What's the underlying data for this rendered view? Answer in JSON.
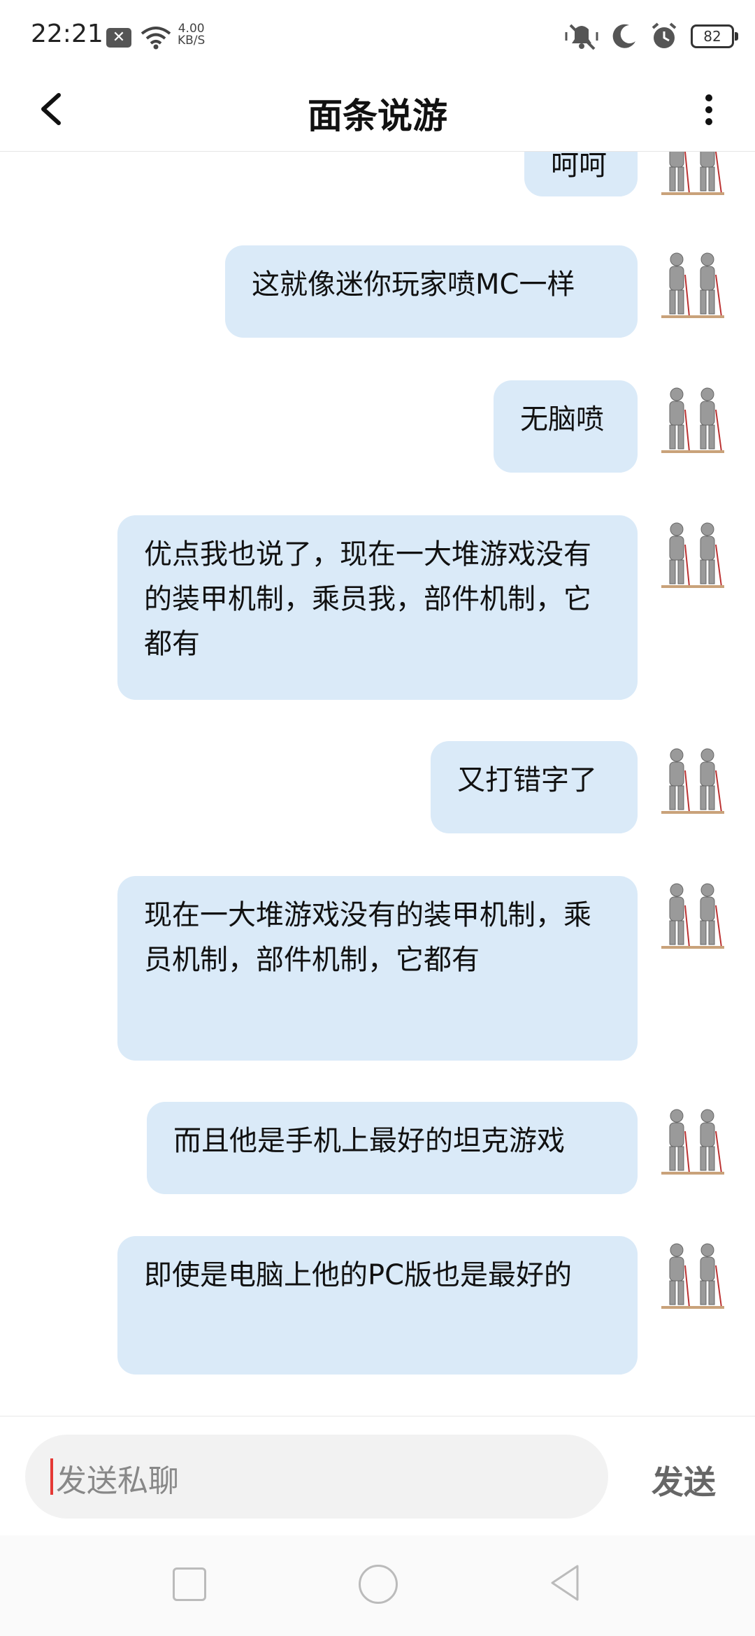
{
  "status_bar": {
    "time": "22:21",
    "net_speed_value": "4.00",
    "net_speed_unit": "KB/S",
    "battery": "82",
    "icons": [
      "notification-x-icon",
      "wifi-icon",
      "mute-vibrate-icon",
      "moon-icon",
      "alarm-icon",
      "battery-icon"
    ]
  },
  "header": {
    "title": "面条说游",
    "back_icon": "chevron-left-icon",
    "more_icon": "more-vertical-icon"
  },
  "messages": [
    {
      "text": "呵呵",
      "avatar": "knights-avatar"
    },
    {
      "text": "这就像迷你玩家喷MC一样",
      "avatar": "knights-avatar"
    },
    {
      "text": "无脑喷",
      "avatar": "knights-avatar"
    },
    {
      "text": "优点我也说了，现在一大堆游戏没有的装甲机制，乘员我，部件机制，它都有",
      "avatar": "knights-avatar"
    },
    {
      "text": "又打错字了",
      "avatar": "knights-avatar"
    },
    {
      "text": "现在一大堆游戏没有的装甲机制，乘员机制，部件机制，它都有",
      "avatar": "knights-avatar"
    },
    {
      "text": "而且他是手机上最好的坦克游戏",
      "avatar": "knights-avatar"
    },
    {
      "text": "即使是电脑上他的PC版也是最好的",
      "avatar": "knights-avatar"
    }
  ],
  "input": {
    "placeholder": "发送私聊",
    "send_label": "发送"
  },
  "nav": {
    "icons": [
      "recent-apps-icon",
      "home-icon",
      "back-triangle-icon"
    ]
  },
  "colors": {
    "bubble": "#daeaf8",
    "cursor": "#e53935"
  }
}
